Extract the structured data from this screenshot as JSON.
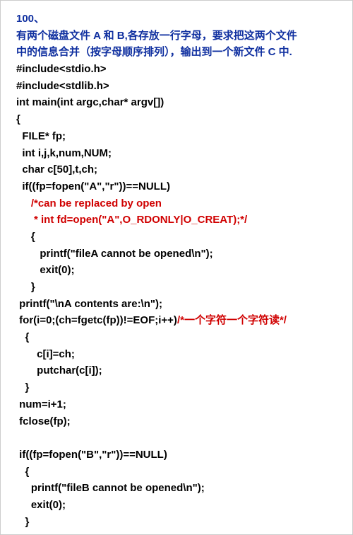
{
  "lines": [
    {
      "parts": [
        {
          "cls": "blue",
          "text": "100、"
        }
      ]
    },
    {
      "parts": [
        {
          "cls": "blue",
          "text": "有两个磁盘文件 A 和 B,各存放一行字母，要求把这两个文件"
        }
      ]
    },
    {
      "parts": [
        {
          "cls": "blue",
          "text": "中的信息合并（按字母顺序排列），输出到一个新文件 C 中."
        }
      ]
    },
    {
      "parts": [
        {
          "cls": "black",
          "text": "#include<stdio.h>"
        }
      ]
    },
    {
      "parts": [
        {
          "cls": "black",
          "text": "#include<stdlib.h>"
        }
      ]
    },
    {
      "parts": [
        {
          "cls": "black",
          "text": "int main(int argc,char* argv[])"
        }
      ]
    },
    {
      "parts": [
        {
          "cls": "black",
          "text": "{"
        }
      ]
    },
    {
      "parts": [
        {
          "cls": "black",
          "text": "  FILE* fp;"
        }
      ]
    },
    {
      "parts": [
        {
          "cls": "black",
          "text": "  int i,j,k,num,NUM;"
        }
      ]
    },
    {
      "parts": [
        {
          "cls": "black",
          "text": "  char c[50],t,ch;"
        }
      ]
    },
    {
      "parts": [
        {
          "cls": "black",
          "text": "  if((fp=fopen(\"A\",\"r\"))==NULL)"
        }
      ]
    },
    {
      "parts": [
        {
          "cls": "red",
          "text": "     /*can be replaced by open"
        }
      ]
    },
    {
      "parts": [
        {
          "cls": "red",
          "text": "      * int fd=open(\"A\",O_RDONLY|O_CREAT);*/"
        }
      ]
    },
    {
      "parts": [
        {
          "cls": "black",
          "text": "     {"
        }
      ]
    },
    {
      "parts": [
        {
          "cls": "black",
          "text": "        printf(\"fileA cannot be opened\\n\");"
        }
      ]
    },
    {
      "parts": [
        {
          "cls": "black",
          "text": "        exit(0);"
        }
      ]
    },
    {
      "parts": [
        {
          "cls": "black",
          "text": "     }"
        }
      ]
    },
    {
      "parts": [
        {
          "cls": "black",
          "text": " printf(\"\\nA contents are:\\n\");"
        }
      ]
    },
    {
      "parts": [
        {
          "cls": "black",
          "text": " for(i=0;(ch=fgetc(fp))!=EOF;i++)"
        },
        {
          "cls": "red",
          "text": "/*一个字符一个字符读*/"
        }
      ]
    },
    {
      "parts": [
        {
          "cls": "black",
          "text": "   {"
        }
      ]
    },
    {
      "parts": [
        {
          "cls": "black",
          "text": "       c[i]=ch;"
        }
      ]
    },
    {
      "parts": [
        {
          "cls": "black",
          "text": "       putchar(c[i]);"
        }
      ]
    },
    {
      "parts": [
        {
          "cls": "black",
          "text": "   }"
        }
      ]
    },
    {
      "parts": [
        {
          "cls": "black",
          "text": " num=i+1;"
        }
      ]
    },
    {
      "parts": [
        {
          "cls": "black",
          "text": " fclose(fp);"
        }
      ]
    },
    {
      "parts": [
        {
          "cls": "black",
          "text": ""
        }
      ]
    },
    {
      "parts": [
        {
          "cls": "black",
          "text": " if((fp=fopen(\"B\",\"r\"))==NULL)"
        }
      ]
    },
    {
      "parts": [
        {
          "cls": "black",
          "text": "   {"
        }
      ]
    },
    {
      "parts": [
        {
          "cls": "black",
          "text": "     printf(\"fileB cannot be opened\\n\");"
        }
      ]
    },
    {
      "parts": [
        {
          "cls": "black",
          "text": "     exit(0);"
        }
      ]
    },
    {
      "parts": [
        {
          "cls": "black",
          "text": "   }"
        }
      ]
    }
  ]
}
